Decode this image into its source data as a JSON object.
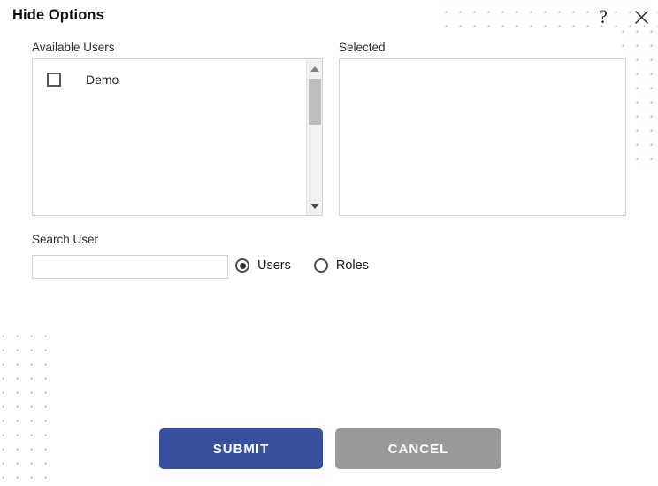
{
  "dialog": {
    "title": "Hide Options",
    "help_icon": "question-mark-icon",
    "close_icon": "close-icon"
  },
  "available_users": {
    "label": "Available Users",
    "items": [
      {
        "label": "Demo",
        "checked": false
      }
    ],
    "scrollbar": {
      "up_arrow": "triangle-up-icon",
      "down_arrow": "triangle-down-icon"
    }
  },
  "selected": {
    "label": "Selected",
    "items": []
  },
  "search": {
    "label": "Search User",
    "value": "",
    "placeholder": "",
    "radio_options": [
      {
        "label": "Users",
        "checked": true
      },
      {
        "label": "Roles",
        "checked": false
      }
    ]
  },
  "footer": {
    "submit_label": "SUBMIT",
    "cancel_label": "CANCEL"
  },
  "colors": {
    "submit_bg": "#37509E",
    "cancel_bg": "#9A9A9A",
    "dot_pattern": "#9AA7E0",
    "border": "#D2D2D2"
  }
}
